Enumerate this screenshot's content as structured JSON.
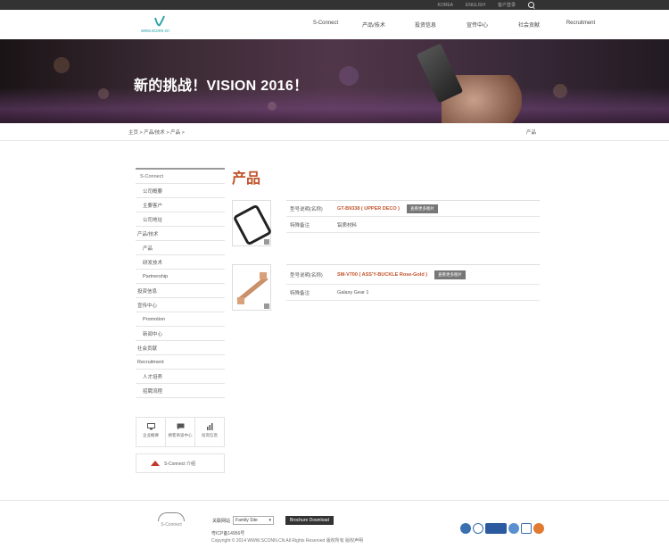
{
  "topbar": {
    "links": [
      "KOREA",
      "ENGLISH",
      "客户登录"
    ]
  },
  "header": {
    "logo_text": "www.sconn.cn",
    "nav": [
      "S-Connect",
      "产品/技术",
      "投资信息",
      "宣传中心",
      "社会贡献",
      "Recruitment"
    ]
  },
  "banner": {
    "headline": "新的挑战！VISION 2016！"
  },
  "breadcrumb": {
    "path": "主页 > 产品/技术 > 产品 >",
    "current": "产品"
  },
  "sidebar": {
    "items": [
      {
        "label": "S-Connect",
        "level": "top"
      },
      {
        "label": "公司概要",
        "level": "2"
      },
      {
        "label": "主要客户",
        "level": "2"
      },
      {
        "label": "公司地址",
        "level": "2"
      },
      {
        "label": "产品/技术",
        "level": "1"
      },
      {
        "label": "产品",
        "level": "2"
      },
      {
        "label": "研发技术",
        "level": "2"
      },
      {
        "label": "Partnership",
        "level": "2"
      },
      {
        "label": "投资信息",
        "level": "1"
      },
      {
        "label": "宣传中心",
        "level": "1"
      },
      {
        "label": "Promotion",
        "level": "2"
      },
      {
        "label": "新闻中心",
        "level": "2"
      },
      {
        "label": "社会贡献",
        "level": "1"
      },
      {
        "label": "Recruitment",
        "level": "1"
      },
      {
        "label": "人才培养",
        "level": "2"
      },
      {
        "label": "招聘流程",
        "level": "2"
      }
    ],
    "quick_links": [
      "企业概要",
      "顾客商谈中心",
      "投资信息"
    ],
    "card_label": "S-Connect 介绍"
  },
  "main": {
    "title": "产品",
    "products": [
      {
        "model_label": "型号说明(名称)",
        "model": "GT-B9338 ( UPPER DECO )",
        "button": "查看更多图片",
        "feature_label": "特殊备注",
        "feature": "铝质材料"
      },
      {
        "model_label": "型号说明(名称)",
        "model": "SM-V700 ( ASS'Y-BUCKLE Rose-Gold )",
        "button": "查看更多图片",
        "feature_label": "特殊备注",
        "feature": "Galaxy Gear 1"
      }
    ]
  },
  "footer": {
    "logo_text": "S-Connect",
    "family_label": "关联网站",
    "family_value": "Family Site",
    "download_button": "Brochure Download",
    "icp": "粤ICP备14956号",
    "copyright": "Copyright © 2014 WWW.SCONN.CN All Rights Reserved 版权所有  版权声明"
  }
}
